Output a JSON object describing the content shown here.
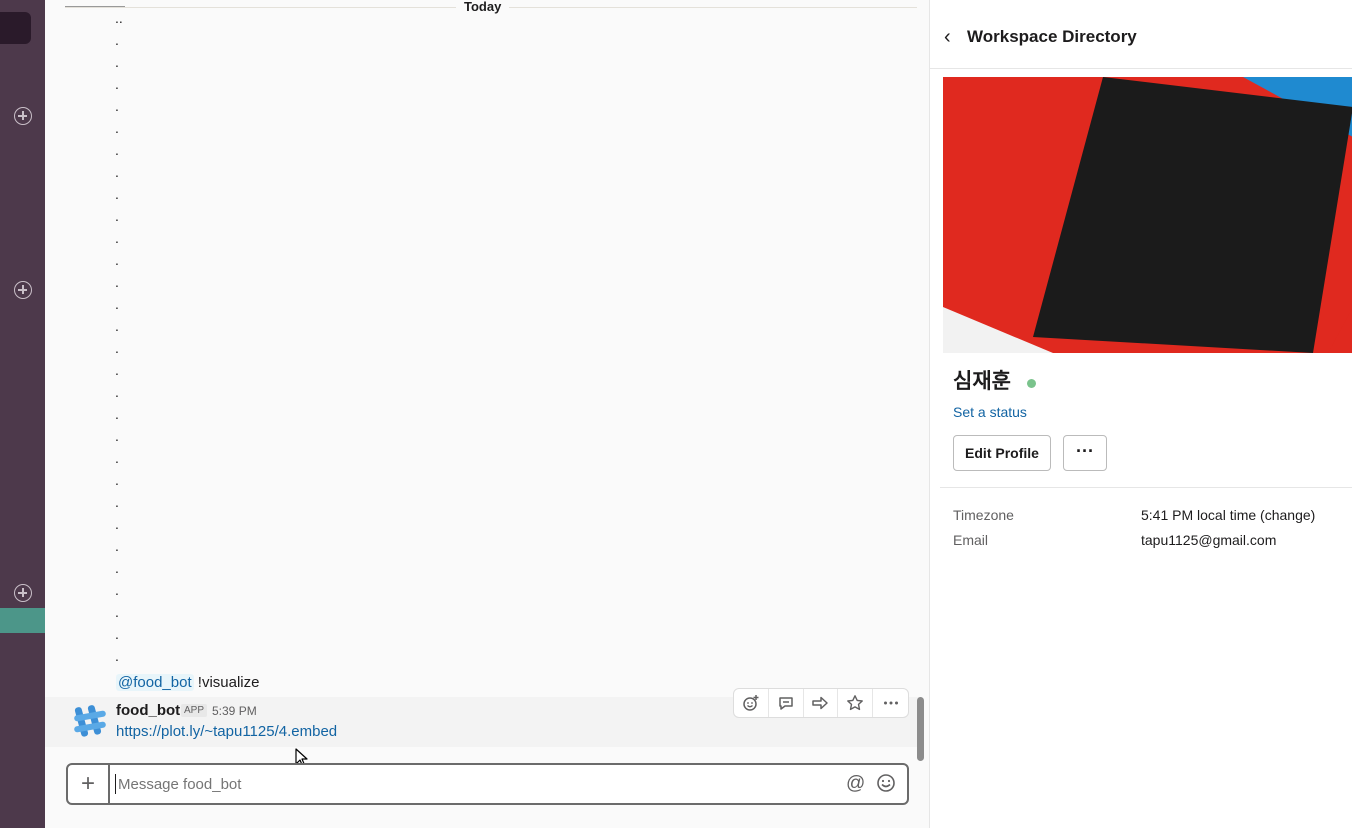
{
  "divider": {
    "label": "Today"
  },
  "thread": {
    "first_line": "..",
    "dot": ".",
    "mention": "@food_bot",
    "command": " !visualize"
  },
  "message": {
    "sender": "food_bot",
    "badge": "APP",
    "time": "5:39 PM",
    "link": "https://plot.ly/~tapu1125/4.embed"
  },
  "message_actions": [
    "add-reaction-icon",
    "reply-thread-icon",
    "share-message-icon",
    "star-icon",
    "more-actions-icon"
  ],
  "composer": {
    "plus": "+",
    "placeholder": "Message food_bot",
    "at": "@"
  },
  "panel": {
    "title": "Workspace Directory",
    "profile_name": "심재훈",
    "status_link": "Set a status",
    "edit_button": "Edit Profile",
    "more_button": "···",
    "fields": [
      {
        "label": "Timezone",
        "value": "5:41 PM local time (change)"
      },
      {
        "label": "Email",
        "value": "tapu1125@gmail.com"
      }
    ]
  },
  "colors": {
    "rail": "#4d394b",
    "rail_active": "#4c9689",
    "link": "#1264a3",
    "presence": "#7ac38c",
    "cover_red": "#e0291f",
    "cover_black": "#1b1b1b",
    "cover_blue": "#1f8ad0"
  }
}
